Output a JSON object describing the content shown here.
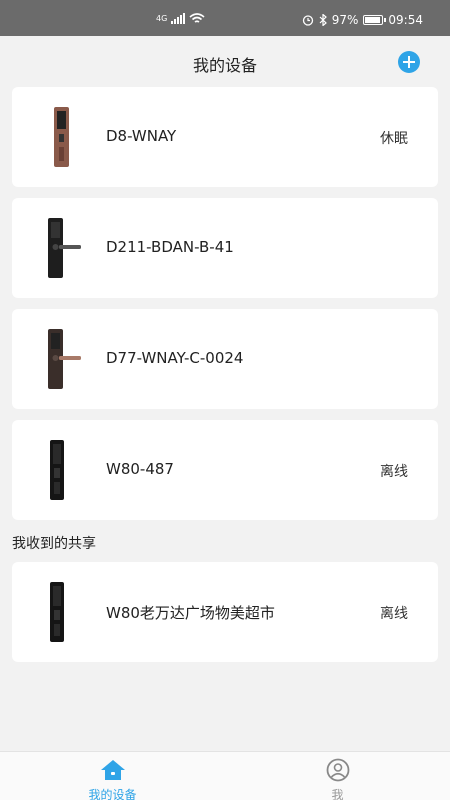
{
  "status_bar": {
    "network": "4G",
    "battery": "97%",
    "battery_level": 0.97,
    "time": "09:54"
  },
  "header": {
    "title": "我的设备"
  },
  "devices": [
    {
      "name": "D8-WNAY",
      "status": "休眠"
    },
    {
      "name": "D211-BDAN-B-41",
      "status": ""
    },
    {
      "name": "D77-WNAY-C-0024",
      "status": ""
    },
    {
      "name": "W80-487",
      "status": "离线"
    }
  ],
  "shared_section": {
    "title": "我收到的共享",
    "devices": [
      {
        "name": "W80老万达广场物美超市",
        "status": "离线"
      }
    ]
  },
  "tabbar": {
    "tabs": [
      {
        "label": "我的设备",
        "icon": "home-icon",
        "active": true
      },
      {
        "label": "我",
        "icon": "user-icon",
        "active": false
      }
    ]
  },
  "colors": {
    "accent": "#2fa4e7",
    "status_bar": "#6b6b6b",
    "background": "#f2f2f2"
  }
}
